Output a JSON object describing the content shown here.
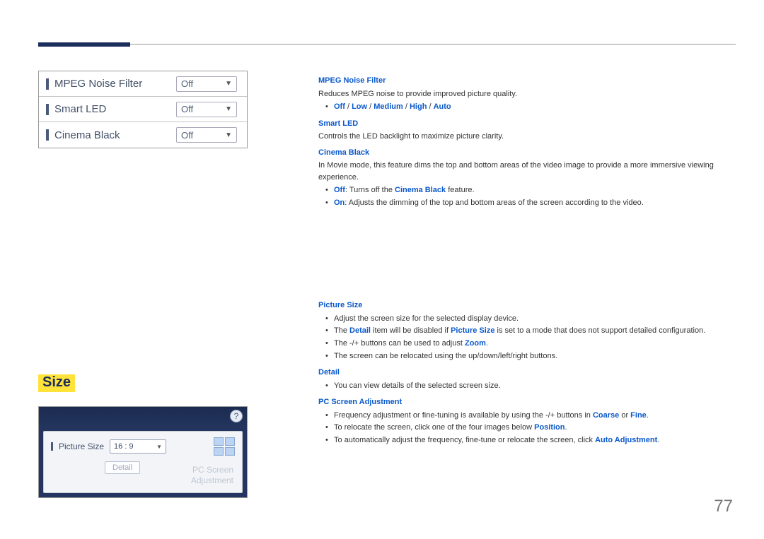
{
  "page_number": "77",
  "shot1": {
    "rows": [
      {
        "label": "MPEG Noise Filter",
        "value": "Off"
      },
      {
        "label": "Smart LED",
        "value": "Off"
      },
      {
        "label": "Cinema Black",
        "value": "Off"
      }
    ]
  },
  "size_tag": "Size",
  "shot2": {
    "label": "Picture Size",
    "value": "16 : 9",
    "detail_btn": "Detail",
    "ghost1": "PC Screen",
    "ghost2": "Adjustment",
    "help": "?"
  },
  "sec1": {
    "h1": "MPEG Noise Filter",
    "p1": "Reduces MPEG noise to provide improved picture quality.",
    "li1_a": "Off",
    "li1_b": "Low",
    "li1_c": "Medium",
    "li1_d": "High",
    "li1_e": "Auto",
    "h2": "Smart LED",
    "p2": "Controls the LED backlight to maximize picture clarity.",
    "h3": "Cinema Black",
    "p3": "In Movie mode, this feature dims the top and bottom areas of the video image to provide a more immersive viewing experience.",
    "li2_off": "Off",
    "li2_off_txt": ": Turns off the ",
    "li2_off_em": "Cinema Black",
    "li2_off_tail": " feature.",
    "li2_on": "On",
    "li2_on_txt": ": Adjusts the dimming of the top and bottom areas of the screen according to the video."
  },
  "sec2": {
    "h1": "Picture Size",
    "li1": "Adjust the screen size for the selected display device.",
    "li2_a": "The ",
    "li2_b": "Detail",
    "li2_c": " item will be disabled if ",
    "li2_d": "Picture Size",
    "li2_e": " is set to a mode that does not support detailed configuration.",
    "li3_a": "The -/+ buttons can be used to adjust ",
    "li3_b": "Zoom",
    "li3_c": ".",
    "li4": "The screen can be relocated using the up/down/left/right buttons.",
    "h2": "Detail",
    "li5": "You can view details of the selected screen size.",
    "h3": "PC Screen Adjustment",
    "li6_a": "Frequency adjustment or fine-tuning is available by using the -/+ buttons in ",
    "li6_b": "Coarse",
    "li6_c": " or ",
    "li6_d": "Fine",
    "li6_e": ".",
    "li7_a": "To relocate the screen, click one of the four images below ",
    "li7_b": "Position",
    "li7_c": ".",
    "li8_a": "To automatically adjust the frequency, fine-tune or relocate the screen, click ",
    "li8_b": "Auto Adjustment",
    "li8_c": "."
  }
}
